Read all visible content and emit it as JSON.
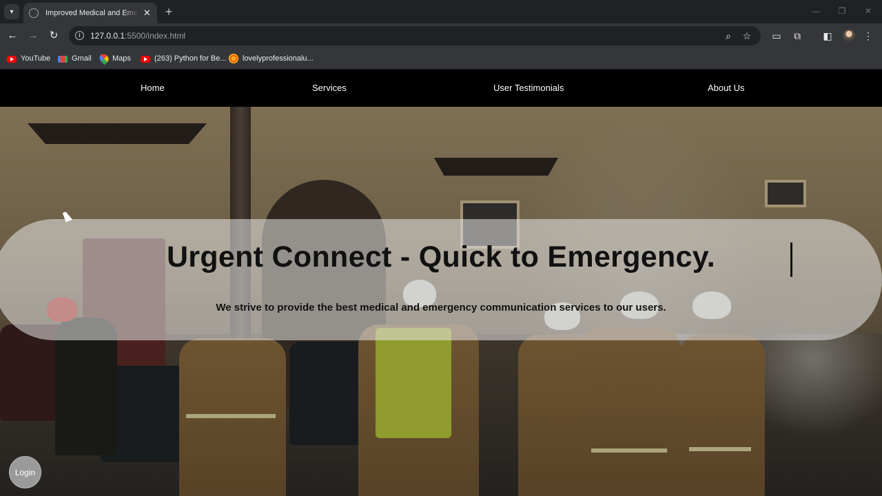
{
  "browser": {
    "tab_title": "Improved Medical and Emergency",
    "tab_close": "✕",
    "new_tab": "+",
    "url_host": "127.0.0.1",
    "url_path": ":5500/index.html",
    "window_controls": {
      "minimize": "—",
      "maximize": "❐",
      "close": "✕"
    },
    "bookmarks": [
      {
        "label": "YouTube",
        "icon": "youtube-icon"
      },
      {
        "label": "Gmail",
        "icon": "gmail-icon"
      },
      {
        "label": "Maps",
        "icon": "maps-icon"
      },
      {
        "label": "(263) Python for Be...",
        "icon": "youtube-icon"
      },
      {
        "label": "lovelyprofessionalu...",
        "icon": "lpu-icon"
      }
    ]
  },
  "navbar": {
    "items": [
      {
        "label": "Home"
      },
      {
        "label": "Services"
      },
      {
        "label": "User Testimonials"
      },
      {
        "label": "About Us"
      }
    ]
  },
  "hero": {
    "title": "Urgent Connect - Quick to Emergency.",
    "subtitle": "We strive to provide the best medical and emergency communication services to our users.",
    "background": "firefighters-photo"
  },
  "login": {
    "label": "Login"
  },
  "colors": {
    "navbar_bg": "#000000",
    "banner_bg": "#e8e8e8",
    "login_bg": "#9a9a9a",
    "chrome_bg": "#35363a"
  }
}
